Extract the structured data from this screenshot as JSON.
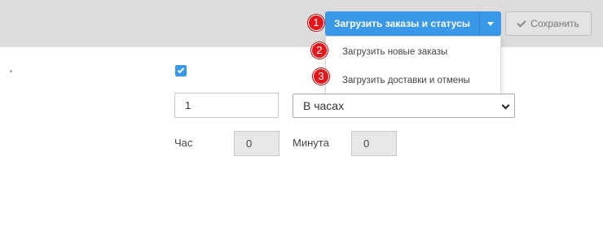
{
  "toolbar": {
    "load_button_label": "Загрузить заказы и статусы",
    "save_button_label": "Сохранить",
    "menu_items": [
      {
        "number": "1"
      },
      {
        "number": "2",
        "label": "Загрузить новые заказы"
      },
      {
        "number": "3",
        "label": "Загрузить доставки и отмены"
      }
    ]
  },
  "form": {
    "enabled_checked": true,
    "interval_value": "1",
    "interval_unit": "В часах",
    "hour_label": "Час",
    "hour_value": "0",
    "minute_label": "Минута",
    "minute_value": "0"
  },
  "colors": {
    "accent": "#3a98e8",
    "badge": "#e8141a",
    "topbar": "#dcdcdc"
  }
}
